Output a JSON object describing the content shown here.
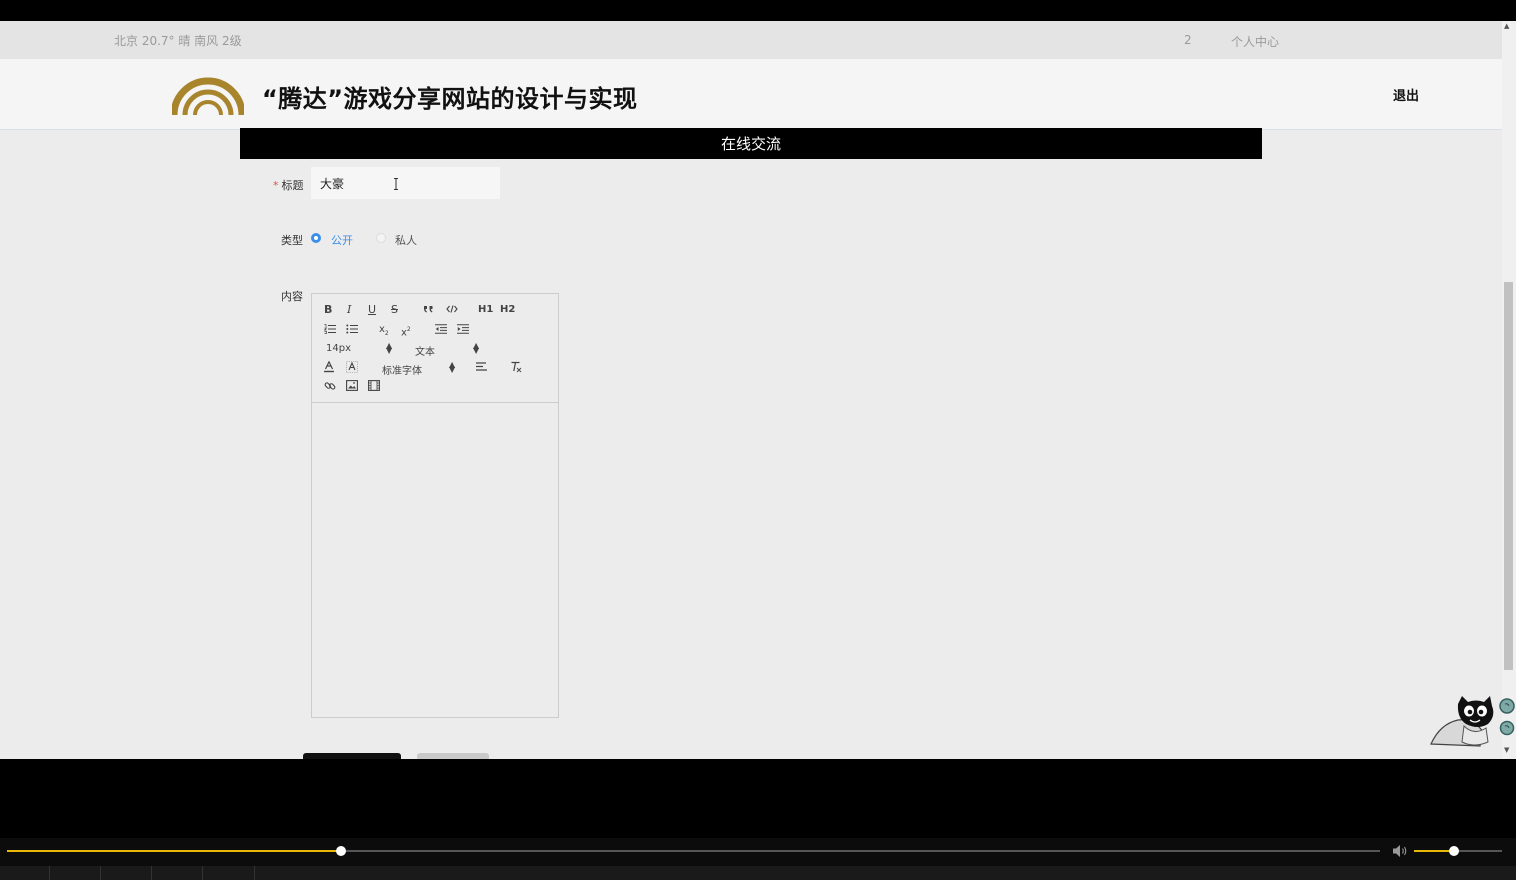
{
  "topbar": {
    "weather": "北京  20.7°  晴  南风  2级",
    "msg_count": "2",
    "user_center": "个人中心"
  },
  "header": {
    "title": "“腾达”游戏分享网站的设计与实现",
    "logout": "退出",
    "logo_color": "#a8842c"
  },
  "section": {
    "title": "在线交流"
  },
  "form": {
    "title_label": "标题",
    "title_required_mark": "*",
    "title_value": "大豪",
    "type_label": "类型",
    "type_options": [
      "公开",
      "私人"
    ],
    "type_selected": "公开",
    "content_label": "内容"
  },
  "editor": {
    "toolbar": {
      "row1": [
        "B",
        "I",
        "U",
        "S",
        "quote-icon",
        "code-icon",
        "H1",
        "H2"
      ],
      "row2": [
        "ordered-list-icon",
        "bullet-list-icon",
        "subscript-icon",
        "superscript-icon",
        "outdent-icon",
        "indent-icon"
      ],
      "font_size": "14px",
      "header_select": "文本",
      "font_family": "标准字体",
      "row5": [
        "link-icon",
        "image-icon",
        "video-icon"
      ]
    }
  },
  "player": {
    "progress": 0.243,
    "volume": 0.45,
    "accent": "#e8b70a"
  }
}
